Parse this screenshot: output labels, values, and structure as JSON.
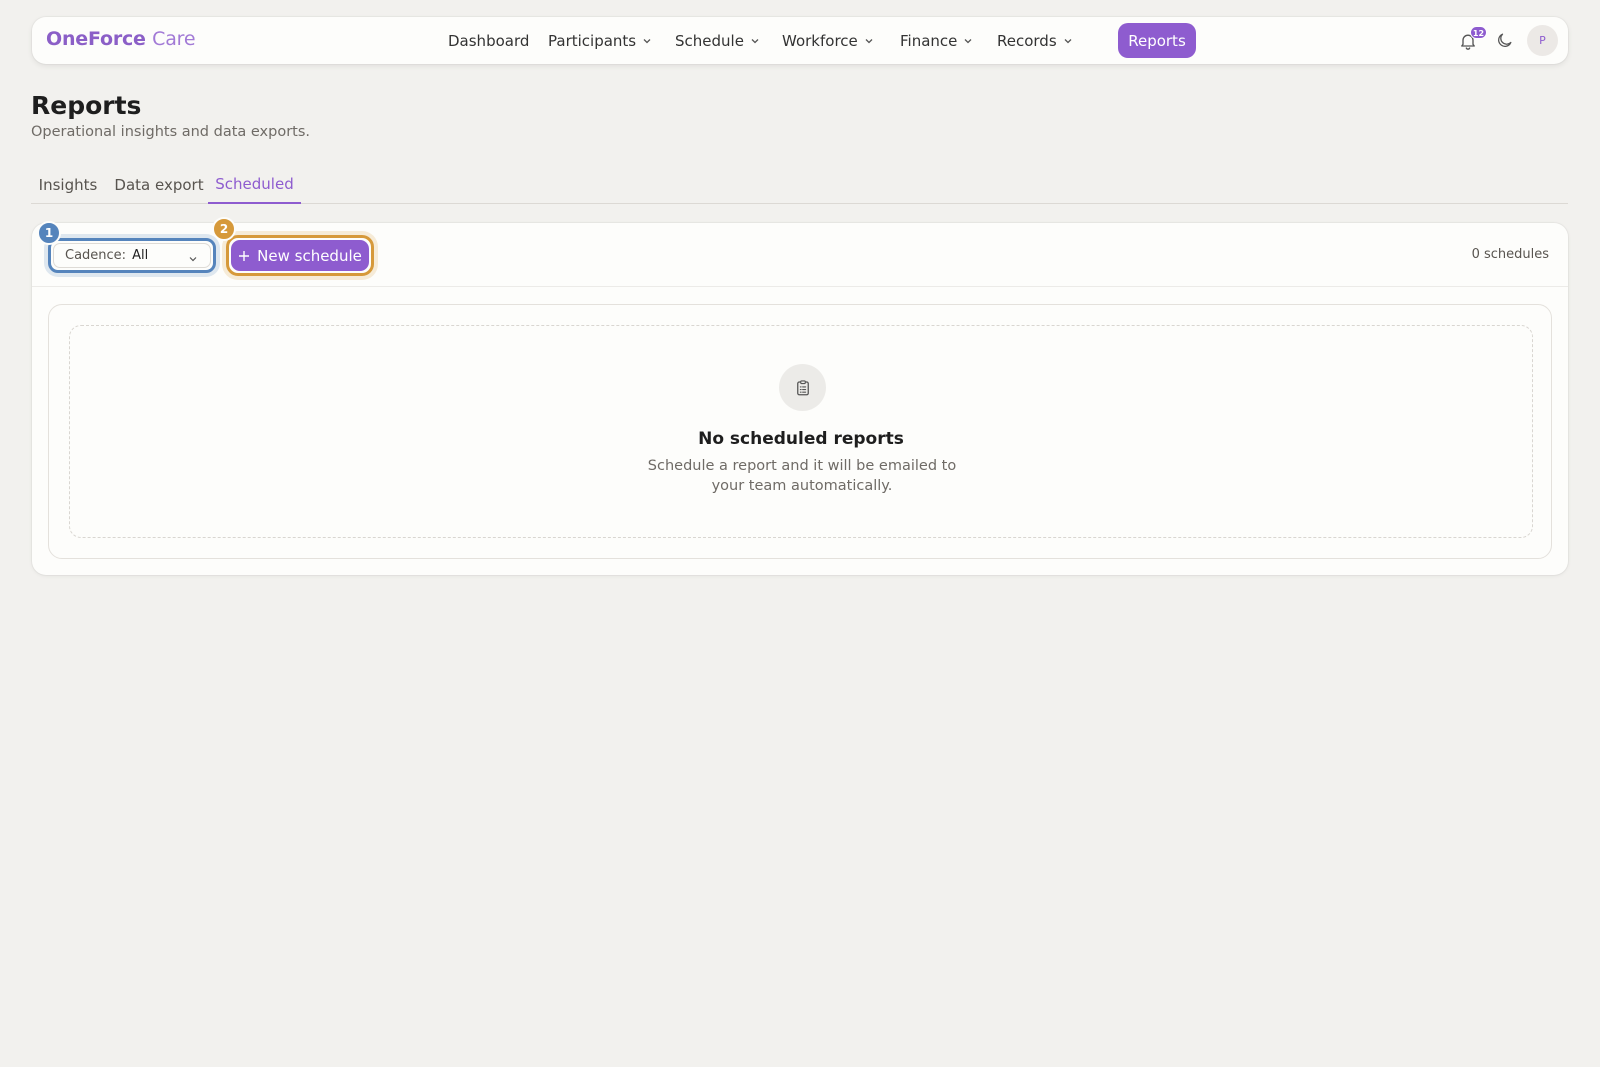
{
  "brand": {
    "name": "OneForce",
    "suffix": "Care",
    "color": "#8e5ccf"
  },
  "nav": {
    "items": [
      {
        "label": "Dashboard"
      },
      {
        "label": "Participants"
      },
      {
        "label": "Schedule"
      },
      {
        "label": "Workforce"
      },
      {
        "label": "Finance"
      },
      {
        "label": "Records"
      }
    ],
    "active": "Reports",
    "notifications_count": "12",
    "avatar_initial": "P",
    "icons": [
      "bell-icon",
      "moon-icon"
    ]
  },
  "page": {
    "title": "Reports",
    "subtitle": "Operational insights and data exports."
  },
  "tabs": [
    {
      "label": "Insights",
      "active": false
    },
    {
      "label": "Data export",
      "active": false
    },
    {
      "label": "Scheduled",
      "active": true
    }
  ],
  "toolbar": {
    "cadence_label": "Cadence:",
    "cadence_value": "All",
    "new_button_label": "New schedule",
    "count_text": "0 schedules",
    "markers": [
      "1",
      "2"
    ]
  },
  "empty_state": {
    "icon": "clipboard-list-icon",
    "title": "No scheduled reports",
    "description": "Schedule a report and it will be emailed to your team automatically."
  },
  "colors": {
    "accent": "#8e5ccf",
    "marker_blue": "#5584bc",
    "marker_orange": "#d6993a",
    "background": "#f2f1ee"
  }
}
